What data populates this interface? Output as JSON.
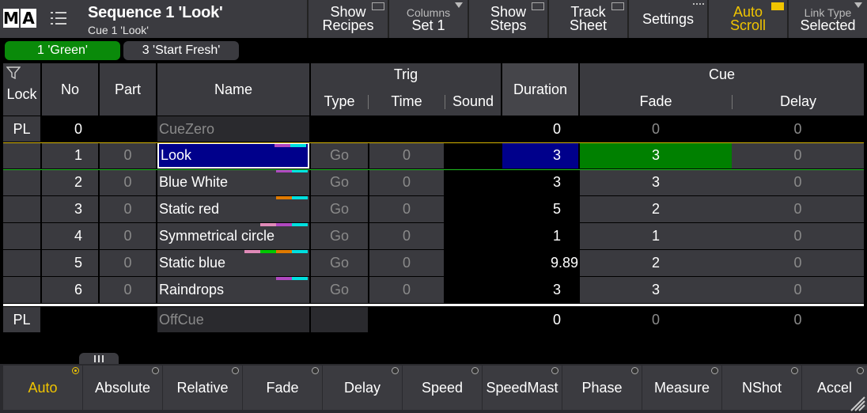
{
  "header": {
    "logo": [
      "M",
      "A"
    ],
    "title": "Sequence 1 'Look'",
    "subtitle": "Cue 1 'Look'",
    "buttons": {
      "show_recipes": {
        "line1": "Show",
        "line2": "Recipes"
      },
      "columns": {
        "label": "Columns",
        "value": "Set 1"
      },
      "show_steps": {
        "line1": "Show",
        "line2": "Steps"
      },
      "track_sheet": {
        "line1": "Track",
        "line2": "Sheet"
      },
      "settings": {
        "line1": "Settings"
      },
      "auto_scroll": {
        "line1": "Auto",
        "line2": "Scroll"
      },
      "link_type": {
        "label": "Link Type",
        "value": "Selected"
      }
    }
  },
  "cue_chips": [
    "1 'Green'",
    "3 'Start Fresh'"
  ],
  "table": {
    "headers": {
      "lock": "Lock",
      "no": "No",
      "part": "Part",
      "name": "Name",
      "trig": "Trig",
      "type": "Type",
      "time": "Time",
      "sound": "Sound",
      "duration": "Duration",
      "cue": "Cue",
      "fade": "Fade",
      "delay": "Delay"
    },
    "zero_row": {
      "lock": "PL",
      "no": "0",
      "name": "CueZero",
      "duration": "0",
      "fade": "0",
      "delay": "0"
    },
    "rows": [
      {
        "no": "1",
        "part": "0",
        "name": "Look",
        "type": "Go",
        "time": "0",
        "duration": "3",
        "fade": "3",
        "delay": "0"
      },
      {
        "no": "2",
        "part": "0",
        "name": "Blue  White",
        "type": "Go",
        "time": "0",
        "duration": "3",
        "fade": "3",
        "delay": "0"
      },
      {
        "no": "3",
        "part": "0",
        "name": "Static  red",
        "type": "Go",
        "time": "0",
        "duration": "5",
        "fade": "2",
        "delay": "0"
      },
      {
        "no": "4",
        "part": "0",
        "name": "Symmetrical  circle",
        "type": "Go",
        "time": "0",
        "duration": "1",
        "fade": "1",
        "delay": "0"
      },
      {
        "no": "5",
        "part": "0",
        "name": "Static  blue",
        "type": "Go",
        "time": "0",
        "duration": "9.89",
        "fade": "2",
        "delay": "0"
      },
      {
        "no": "6",
        "part": "0",
        "name": "Raindrops",
        "type": "Go",
        "time": "0",
        "duration": "3",
        "fade": "3",
        "delay": "0"
      }
    ],
    "off_row": {
      "lock": "PL",
      "name": "OffCue",
      "duration": "0",
      "fade": "0",
      "delay": "0"
    }
  },
  "bottom_buttons": [
    "Auto",
    "Absolute",
    "Relative",
    "Fade",
    "Delay",
    "Speed",
    "SpeedMast",
    "Phase",
    "Measure",
    "NShot",
    "Accel"
  ],
  "colors": {
    "accent": "#f0c400",
    "selected_name_bg": "#00008b",
    "fade_active_bg": "#008000",
    "chip_green": "#0a8a0a",
    "chip_gray": "#3b3b40"
  }
}
